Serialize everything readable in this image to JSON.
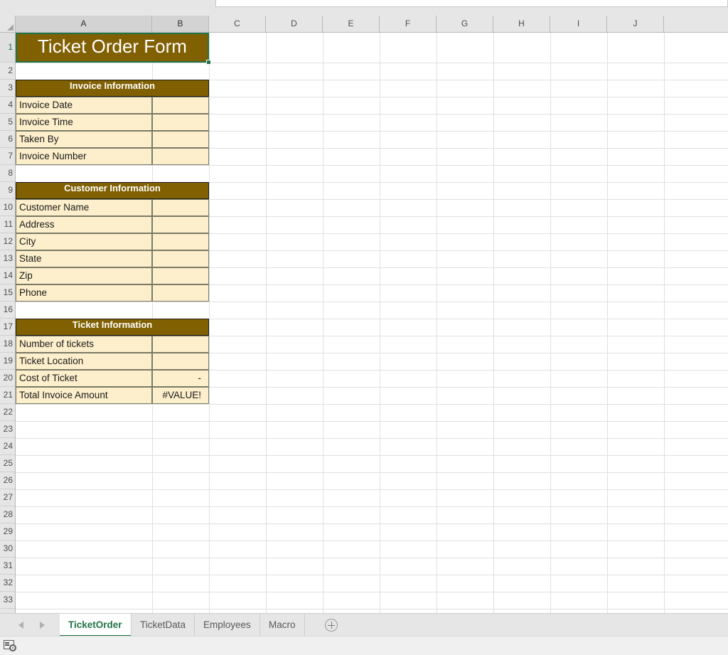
{
  "workbook": {
    "active_sheet": "TicketOrder",
    "sheet_tabs": [
      {
        "label": "TicketOrder",
        "active": true
      },
      {
        "label": "TicketData",
        "active": false
      },
      {
        "label": "Employees",
        "active": false
      },
      {
        "label": "Macro",
        "active": false
      }
    ],
    "add_sheet_label": "+"
  },
  "colors": {
    "header_brown": "#806000",
    "cell_cream": "#fdefcb",
    "accent_green": "#217346",
    "error_marker_green": "#1f7a37",
    "header_text": "#ffffff"
  },
  "grid": {
    "column_headers": [
      "A",
      "B",
      "C",
      "D",
      "E",
      "F",
      "G",
      "H",
      "I",
      "J"
    ],
    "row_headers": [
      "1",
      "2",
      "3",
      "4",
      "5",
      "6",
      "7",
      "8",
      "9",
      "10",
      "11",
      "12",
      "13",
      "14",
      "15",
      "16",
      "17",
      "18",
      "19",
      "20",
      "21",
      "22",
      "23",
      "24",
      "25",
      "26",
      "27",
      "28",
      "29",
      "30",
      "31",
      "32",
      "33"
    ],
    "selected_cell": "A1",
    "selected_row": "1"
  },
  "sheet": {
    "title": "Ticket Order Form",
    "sections": [
      {
        "banner": "Invoice Information",
        "banner_row": "3",
        "rows": [
          {
            "row": "4",
            "label": "Invoice Date",
            "value": ""
          },
          {
            "row": "5",
            "label": "Invoice Time",
            "value": ""
          },
          {
            "row": "6",
            "label": "Taken By",
            "value": ""
          },
          {
            "row": "7",
            "label": "Invoice Number",
            "value": ""
          }
        ]
      },
      {
        "banner": "Customer Information",
        "banner_row": "9",
        "rows": [
          {
            "row": "10",
            "label": "Customer Name",
            "value": ""
          },
          {
            "row": "11",
            "label": "Address",
            "value": ""
          },
          {
            "row": "12",
            "label": "City",
            "value": ""
          },
          {
            "row": "13",
            "label": "State",
            "value": ""
          },
          {
            "row": "14",
            "label": "Zip",
            "value": ""
          },
          {
            "row": "15",
            "label": "Phone",
            "value": ""
          }
        ]
      },
      {
        "banner": "Ticket Information",
        "banner_row": "17",
        "rows": [
          {
            "row": "18",
            "label": "Number of tickets",
            "value": ""
          },
          {
            "row": "19",
            "label": "Ticket Location",
            "value": ""
          },
          {
            "row": "20",
            "label": "Cost of Ticket",
            "value": "-"
          },
          {
            "row": "21",
            "label": "Total Invoice Amount",
            "value": "#VALUE!"
          }
        ]
      }
    ]
  },
  "status_bar": {
    "macro_icon": "macro-record-icon"
  }
}
